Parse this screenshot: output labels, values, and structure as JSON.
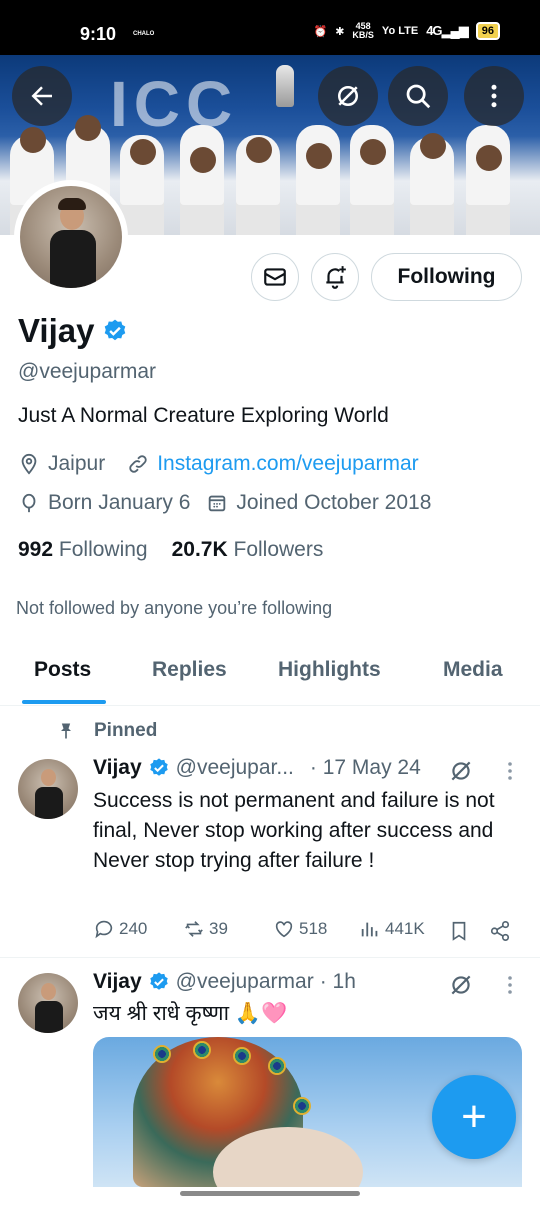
{
  "status_bar": {
    "time": "9:10",
    "app_label": "CHALO",
    "net_speed_value": "458",
    "net_speed_unit": "KB/S",
    "network": "Yo LTE",
    "signal": "4G",
    "battery": "96"
  },
  "banner": {
    "text": "ICC"
  },
  "profile": {
    "name": "Vijay",
    "handle": "@veejuparmar",
    "bio": "Just A Normal Creature Exploring World",
    "location": "Jaipur",
    "website": "Instagram.com/veejuparmar",
    "birthday": "Born January 6",
    "joined": "Joined October 2018",
    "following_count": "992",
    "following_label": "Following",
    "followers_count": "20.7K",
    "followers_label": "Followers",
    "not_followed_text": "Not followed by anyone you’re following",
    "follow_button_label": "Following"
  },
  "tabs": [
    {
      "label": "Posts",
      "active": true
    },
    {
      "label": "Replies",
      "active": false
    },
    {
      "label": "Highlights",
      "active": false
    },
    {
      "label": "Media",
      "active": false
    }
  ],
  "posts": [
    {
      "pinned_label": "Pinned",
      "name": "Vijay",
      "handle": "@veejupar...",
      "date": "· 17 May 24",
      "text": "Success is not permanent and failure is not final, Never stop working after success and Never stop trying after failure !",
      "replies": "240",
      "reposts": "39",
      "likes": "518",
      "views": "441K"
    },
    {
      "name": "Vijay",
      "handle": "@veejuparmar",
      "date": "· 1h",
      "text": "जय श्री राधे कृष्णा 🙏🩷"
    }
  ],
  "colors": {
    "accent": "#1d9bf0",
    "text_primary": "#0f1419",
    "text_secondary": "#536471",
    "border": "#cfd9de"
  }
}
